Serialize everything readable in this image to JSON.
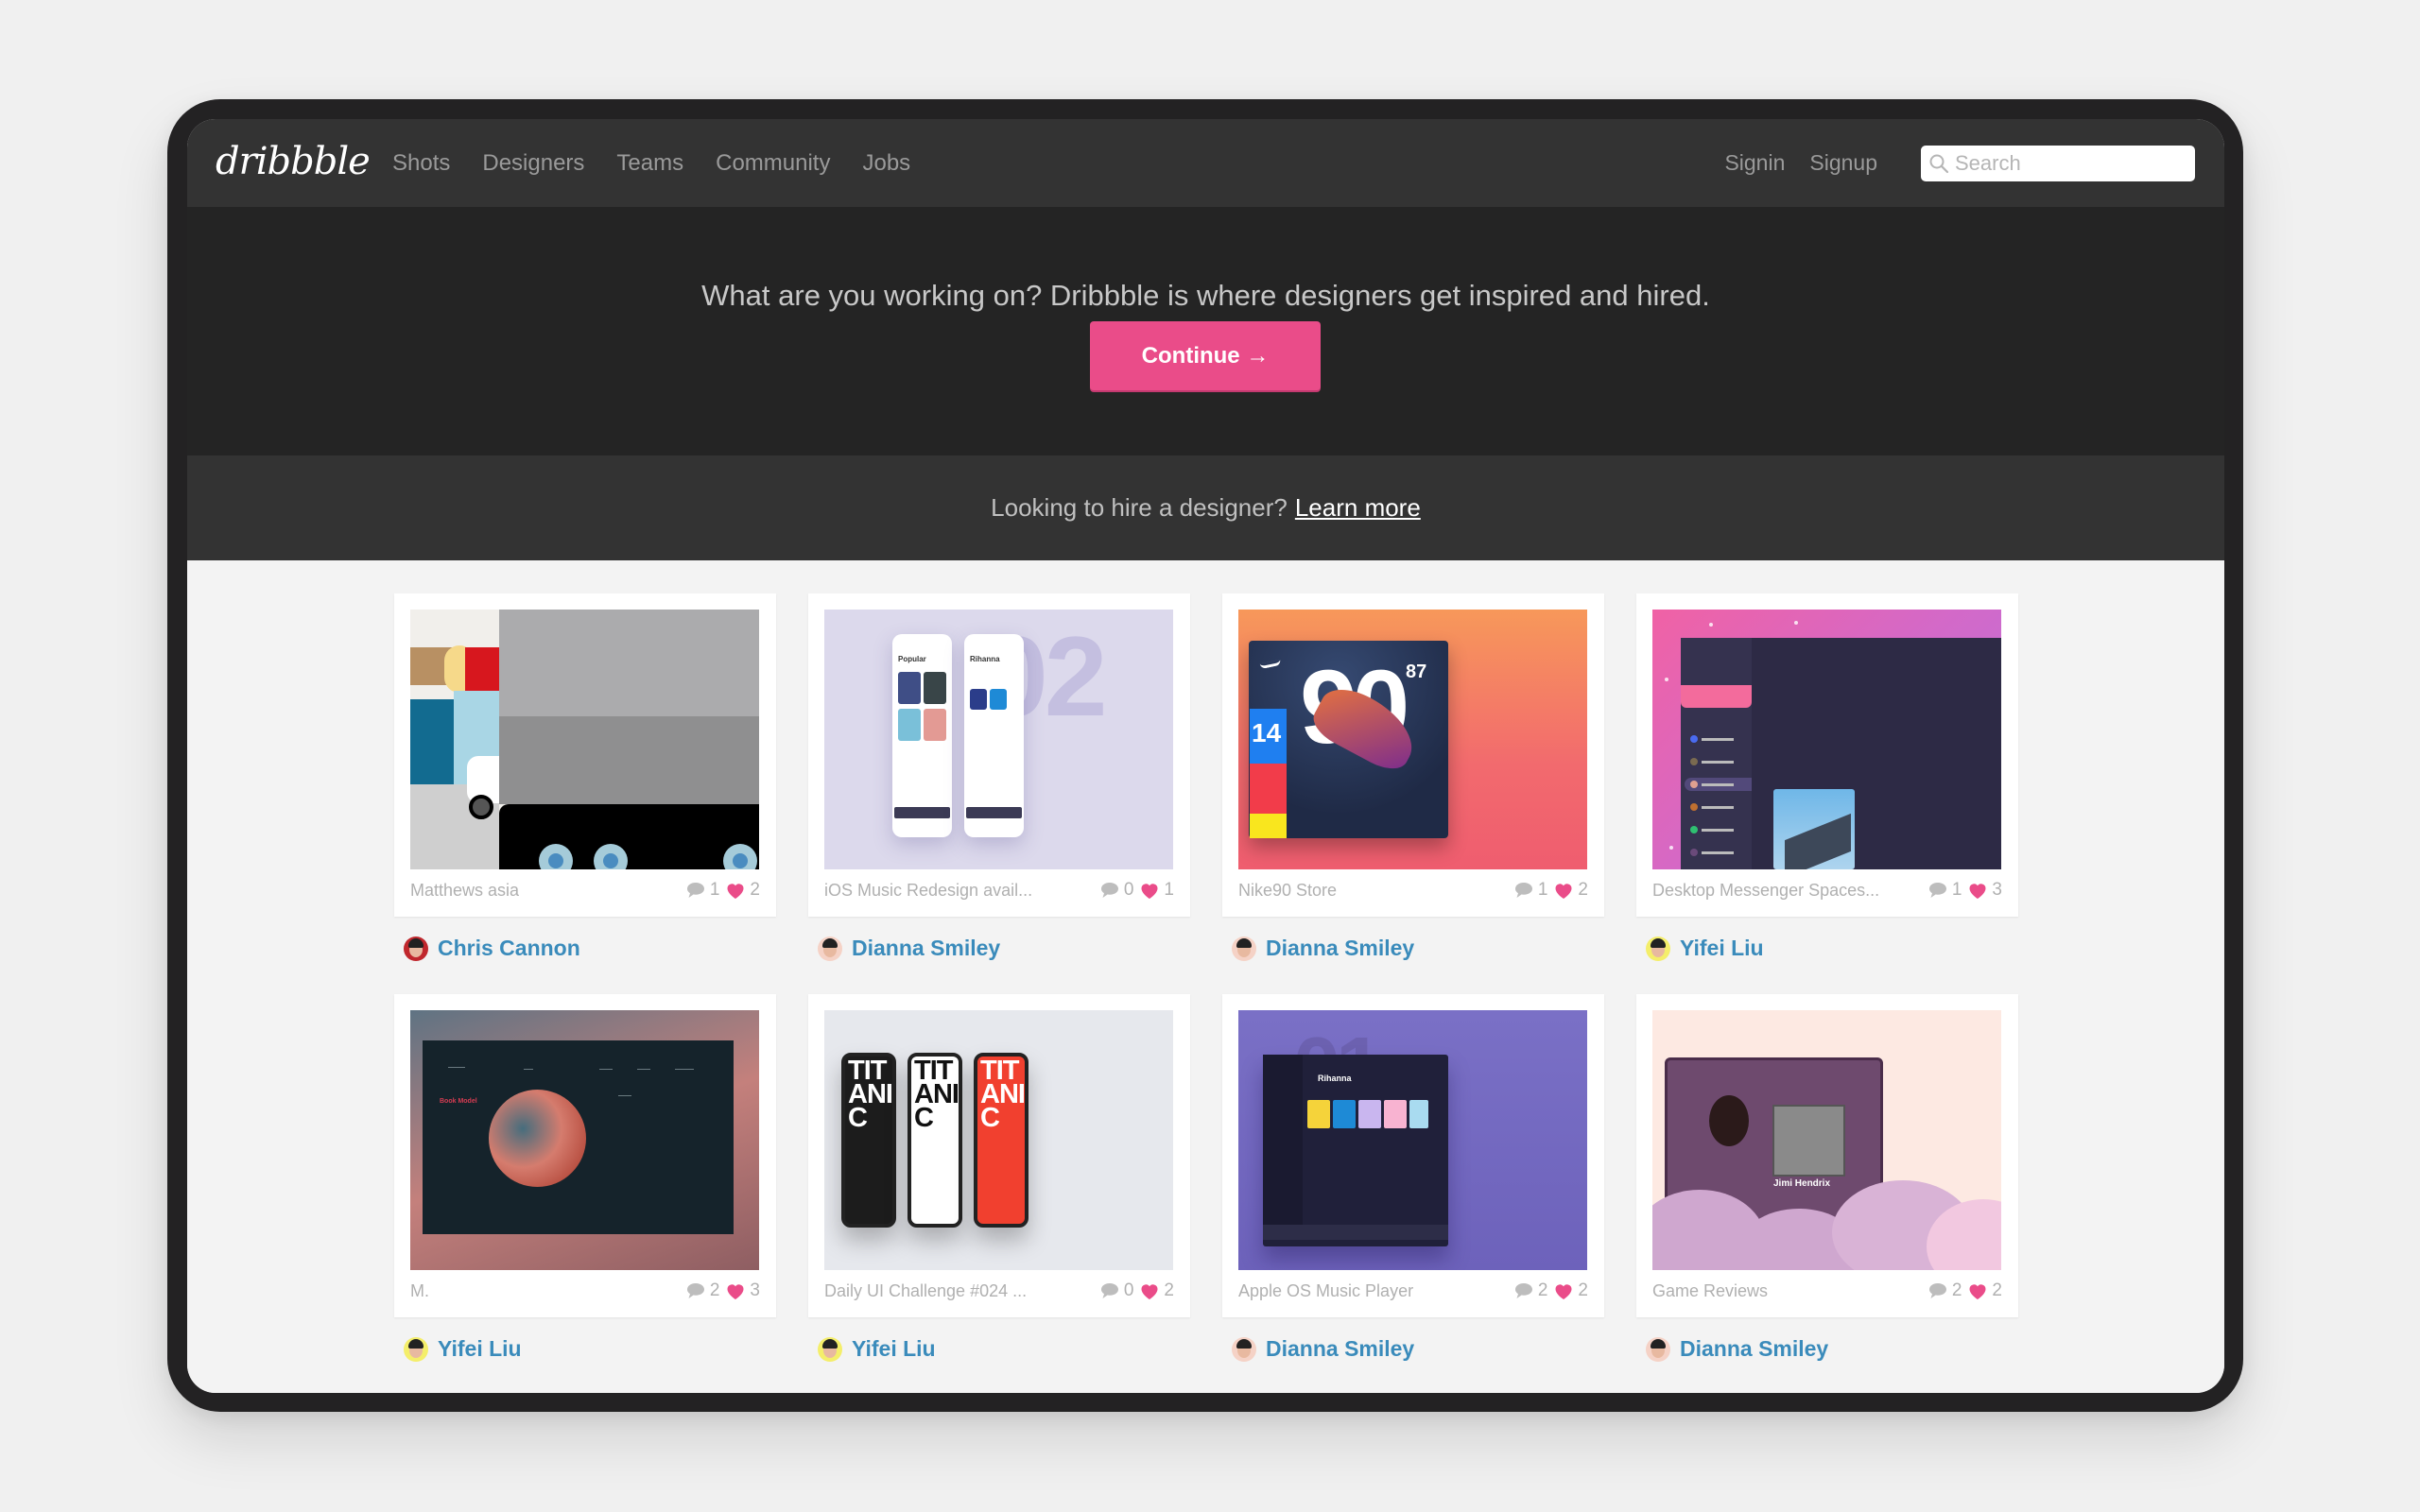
{
  "nav": {
    "logo": "dribbble",
    "links": [
      "Shots",
      "Designers",
      "Teams",
      "Community",
      "Jobs"
    ],
    "signin": "Signin",
    "signup": "Signup",
    "search": {
      "placeholder": "Search",
      "value": ""
    }
  },
  "hero": {
    "headline": "What are you working on? Dribbble is where designers get inspired and hired.",
    "cta": "Continue →"
  },
  "hire": {
    "text": "Looking to hire a designer?",
    "link": "Learn more"
  },
  "colors": {
    "accent": "#ea4c89",
    "author_link": "#3a8bbb",
    "nav_bg": "#333333",
    "hero_bg": "#242424"
  },
  "shots": [
    {
      "title": "Matthews asia",
      "comments": "1",
      "likes": "2",
      "author": "Chris Cannon"
    },
    {
      "title": "iOS Music Redesign avail...",
      "comments": "0",
      "likes": "1",
      "author": "Dianna Smiley"
    },
    {
      "title": "Nike90 Store",
      "comments": "1",
      "likes": "2",
      "author": "Dianna Smiley"
    },
    {
      "title": "Desktop Messenger Spaces...",
      "comments": "1",
      "likes": "3",
      "author": "Yifei Liu"
    },
    {
      "title": "M.",
      "comments": "2",
      "likes": "3",
      "author": "Yifei Liu"
    },
    {
      "title": "Daily UI Challenge #024 ...",
      "comments": "0",
      "likes": "2",
      "author": "Yifei Liu"
    },
    {
      "title": "Apple OS Music Player",
      "comments": "2",
      "likes": "2",
      "author": "Dianna Smiley"
    },
    {
      "title": "Game Reviews",
      "comments": "2",
      "likes": "2",
      "author": "Dianna Smiley"
    }
  ],
  "thumb_text": {
    "ios_big": "02",
    "ios_popular": "Popular",
    "ios_rihanna": "Rihanna",
    "nike_90": "90",
    "nike_87": "87",
    "nike_14": "14",
    "m_book": "Book Model",
    "titanic": "TIT ANI C",
    "apple_big": "01",
    "apple_name": "Rihanna",
    "game_title": "Jimi Hendrix"
  }
}
